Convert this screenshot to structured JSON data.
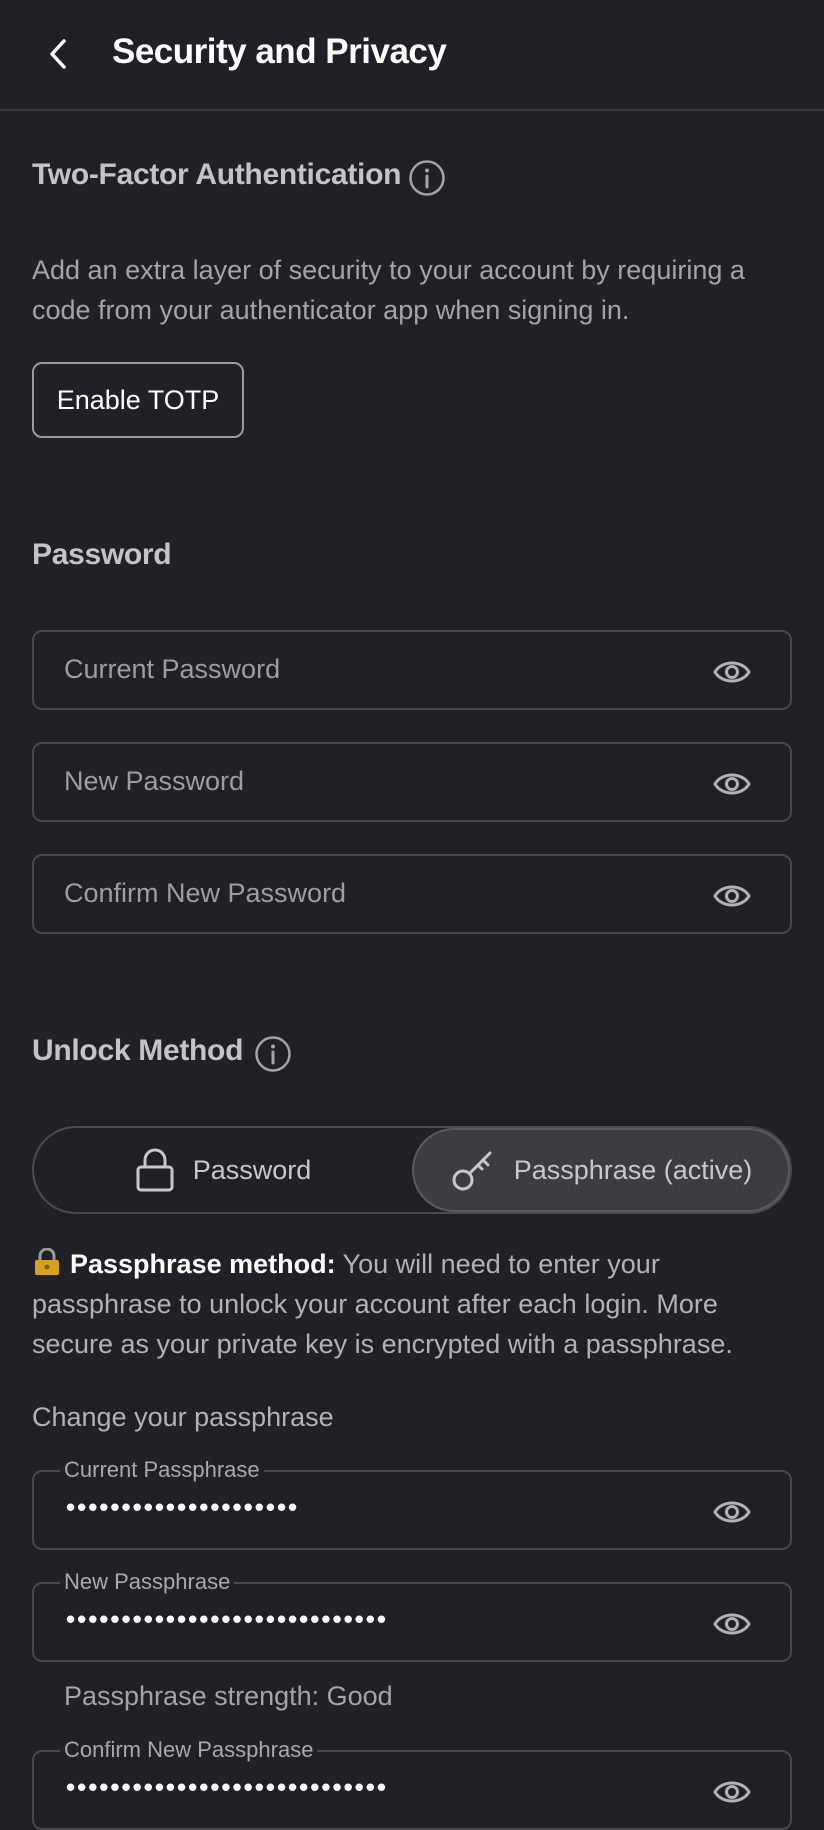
{
  "header": {
    "title": "Security and Privacy"
  },
  "two_factor": {
    "title": "Two-Factor Authentication",
    "description": "Add an extra layer of security to your account by requiring a code from your authenticator app when signing in.",
    "enable_button": "Enable TOTP"
  },
  "password": {
    "title": "Password",
    "fields": [
      {
        "placeholder": "Current Password"
      },
      {
        "placeholder": "New Password"
      },
      {
        "placeholder": "Confirm New Password"
      }
    ]
  },
  "unlock_method": {
    "title": "Unlock Method",
    "options": [
      {
        "label": "Password",
        "icon": "lock-icon",
        "active": false
      },
      {
        "label": "Passphrase (active)",
        "icon": "key-icon",
        "active": true
      }
    ],
    "note_bold": "Passphrase method:",
    "note_text": " You will need to enter your passphrase to unlock your account after each login. More secure as your private key is encrypted with a passphrase."
  },
  "passphrase": {
    "subtitle": "Change your passphrase",
    "fields": [
      {
        "label": "Current Passphrase",
        "value": "•••••••••••••••••••••"
      },
      {
        "label": "New Passphrase",
        "value": "•••••••••••••••••••••••••••••"
      },
      {
        "label": "Confirm New Passphrase",
        "value": "•••••••••••••••••••••••••••••"
      }
    ],
    "strength": "Passphrase strength: Good"
  },
  "colors": {
    "background": "#212026",
    "border": "#47474d",
    "active_toggle": "#3d3c43"
  }
}
